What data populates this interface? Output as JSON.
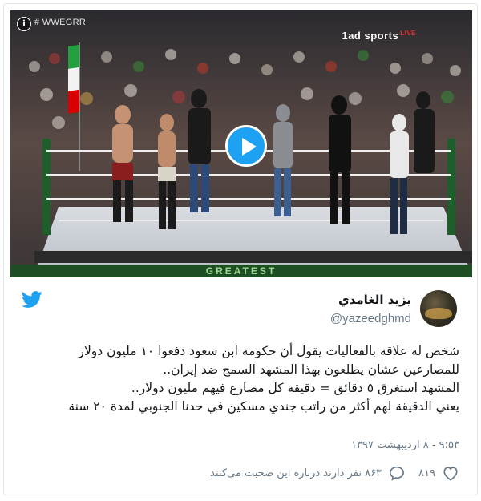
{
  "media": {
    "hashtag": "# WWEGRR",
    "channel_logo": "1ad sports",
    "channel_live": "LIVE",
    "banner_text": "GREATEST",
    "info_icon": "info-icon",
    "play_icon": "play-icon"
  },
  "tweet": {
    "display_name": "یزید الغامدي",
    "handle": "@yazeedghmd",
    "text_lines": [
      "شخص له علاقة بالفعاليات يقول أن حكومة ابن سعود دفعوا ١٠ مليون دولار",
      "للمصارعين عشان يطلعون بهذا المشهد السمج ضد إيران..",
      "المشهد استغرق ٥ دقائق = دقيقة كل مصارع فيهم مليون دولار..",
      "يعني الدقيقة لهم أكثر من راتب جندي مسكين في حدنا الجنوبي لمدة ٢٠ سنة"
    ],
    "timestamp": "۹:۵۳ - ۸ اردیبهشت ۱۳۹۷",
    "likes": "۸۱۹",
    "replies_text": "۸۶۳ نفر دارند درباره این صحبت می‌کنند"
  },
  "icons": {
    "brand": "twitter-bird-icon",
    "like": "heart-icon",
    "reply": "speech-bubble-icon"
  },
  "colors": {
    "twitter_blue": "#1da1f2",
    "text_primary": "#14171a",
    "text_secondary": "#657786"
  }
}
